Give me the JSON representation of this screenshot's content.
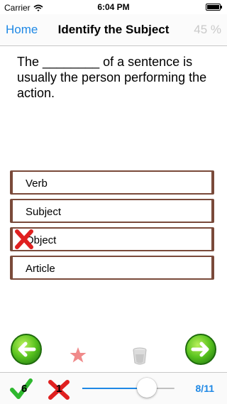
{
  "status_bar": {
    "carrier": "Carrier",
    "time": "6:04 PM"
  },
  "nav": {
    "back_label": "Home",
    "title": "Identify the Subject",
    "percent": "45 %"
  },
  "question": {
    "text": "The ________ of a sentence is usually the person performing the action."
  },
  "options": [
    {
      "label": "Verb",
      "marked_wrong": false
    },
    {
      "label": "Subject",
      "marked_wrong": false
    },
    {
      "label": "Object",
      "marked_wrong": true
    },
    {
      "label": "Article",
      "marked_wrong": false
    }
  ],
  "toolbar": {
    "correct_count": "6",
    "wrong_count": "1",
    "progress_fraction": 0.7,
    "page_indicator": "8/11"
  },
  "icons": {
    "prev": "arrow-left-icon",
    "next": "arrow-right-icon",
    "star": "star-icon",
    "cup": "cup-icon",
    "check": "checkmark-icon",
    "cross": "cross-icon"
  },
  "colors": {
    "accent": "#1e88e5",
    "option_border": "#7a4a3a",
    "correct_green": "#2eb82e",
    "wrong_red": "#e02020",
    "star_pink": "#f08a8a",
    "percent_gray": "#c9c9c9"
  }
}
